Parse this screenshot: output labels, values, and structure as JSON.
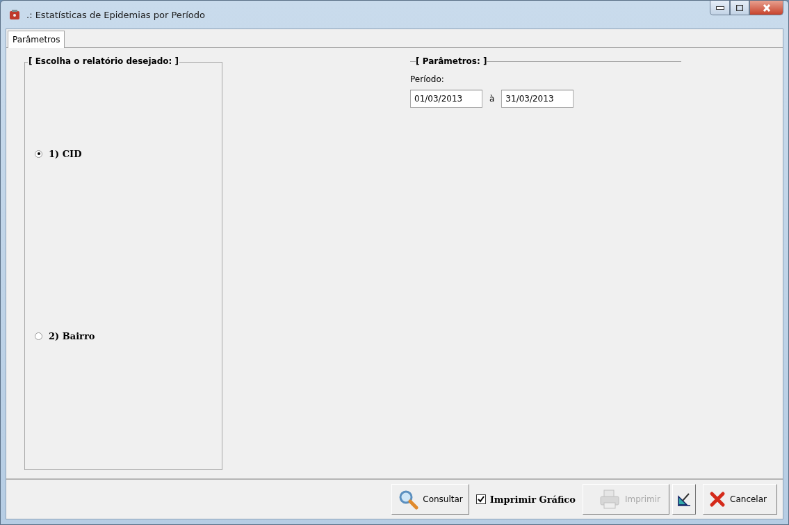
{
  "window": {
    "title": ".: Estatísticas de Epidemias por Período"
  },
  "tabs": [
    {
      "label": "Parâmetros",
      "selected": true
    }
  ],
  "report_group": {
    "title": "[ Escolha o relatório desejado: ]",
    "options": [
      {
        "label": "1) CID",
        "selected": true
      },
      {
        "label": "2) Bairro",
        "selected": false
      }
    ]
  },
  "parameters_group": {
    "title": "[ Parâmetros: ]",
    "period_label": "Período:",
    "start_date": "01/03/2013",
    "separator": "à",
    "end_date": "31/03/2013"
  },
  "toolbar": {
    "consult_button": "Consultar",
    "print_chart": {
      "label": "Imprimir Gráfico",
      "checked": true
    },
    "print_button": {
      "label": "Imprimir",
      "disabled": true
    },
    "cancel_button": "Cancelar"
  }
}
